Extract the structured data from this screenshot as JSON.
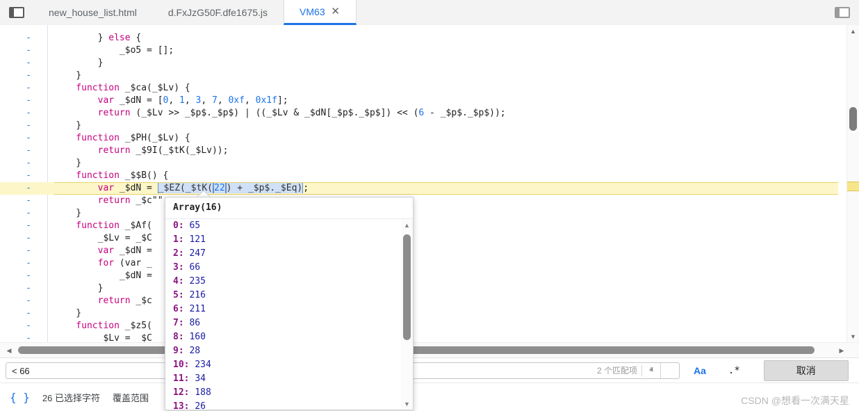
{
  "window": {
    "left_panel_toggle": "toggle-left-panel",
    "right_panel_toggle": "toggle-right-panel"
  },
  "tabs": [
    {
      "label": "new_house_list.html",
      "active": false,
      "closable": false
    },
    {
      "label": "d.FxJzG50F.dfe1675.js",
      "active": false,
      "closable": false
    },
    {
      "label": "VM63",
      "active": true,
      "closable": true,
      "close_glyph": "✕"
    }
  ],
  "editor": {
    "gutter_marker": "-",
    "lines": [
      {
        "indent": 0,
        "clipped": true,
        "tokens": []
      },
      {
        "tokens": [
          {
            "t": "pl",
            "v": "        } "
          },
          {
            "t": "kw",
            "v": "else"
          },
          {
            "t": "pl",
            "v": " {"
          }
        ]
      },
      {
        "tokens": [
          {
            "t": "pl",
            "v": "            _$o5 = [];"
          }
        ]
      },
      {
        "tokens": [
          {
            "t": "pl",
            "v": "        }"
          }
        ]
      },
      {
        "tokens": [
          {
            "t": "pl",
            "v": "    }"
          }
        ]
      },
      {
        "tokens": [
          {
            "t": "kw",
            "v": "    function"
          },
          {
            "t": "pl",
            "v": " _$ca(_$Lv) {"
          }
        ]
      },
      {
        "tokens": [
          {
            "t": "kw",
            "v": "        var"
          },
          {
            "t": "pl",
            "v": " _$dN = ["
          },
          {
            "t": "num",
            "v": "0"
          },
          {
            "t": "pl",
            "v": ", "
          },
          {
            "t": "num",
            "v": "1"
          },
          {
            "t": "pl",
            "v": ", "
          },
          {
            "t": "num",
            "v": "3"
          },
          {
            "t": "pl",
            "v": ", "
          },
          {
            "t": "num",
            "v": "7"
          },
          {
            "t": "pl",
            "v": ", "
          },
          {
            "t": "num",
            "v": "0xf"
          },
          {
            "t": "pl",
            "v": ", "
          },
          {
            "t": "num",
            "v": "0x1f"
          },
          {
            "t": "pl",
            "v": "];"
          }
        ]
      },
      {
        "tokens": [
          {
            "t": "kw",
            "v": "        return"
          },
          {
            "t": "pl",
            "v": " (_$Lv >> _$p$._$p$) | ((_$Lv & _$dN[_$p$._$p$]) << ("
          },
          {
            "t": "num",
            "v": "6"
          },
          {
            "t": "pl",
            "v": " - _$p$._$p$));"
          }
        ]
      },
      {
        "tokens": [
          {
            "t": "pl",
            "v": "    }"
          }
        ]
      },
      {
        "tokens": [
          {
            "t": "kw",
            "v": "    function"
          },
          {
            "t": "pl",
            "v": " _$PH(_$Lv) {"
          }
        ]
      },
      {
        "tokens": [
          {
            "t": "kw",
            "v": "        return"
          },
          {
            "t": "pl",
            "v": " _$9I(_$tK(_$Lv));"
          }
        ]
      },
      {
        "tokens": [
          {
            "t": "pl",
            "v": "    }"
          }
        ]
      },
      {
        "tokens": [
          {
            "t": "kw",
            "v": "    function"
          },
          {
            "t": "pl",
            "v": " _$$B() {"
          }
        ]
      },
      {
        "highlighted": true,
        "tokens": [
          {
            "t": "kw",
            "v": "        var"
          },
          {
            "t": "pl",
            "v": " _$dN = "
          },
          {
            "t": "sel",
            "v": "_$EZ(_$tK("
          },
          {
            "t": "selnum",
            "v": "22"
          },
          {
            "t": "sel",
            "v": ") + _$p$._$Eq)"
          },
          {
            "t": "pl",
            "v": ";"
          }
        ]
      },
      {
        "tokens": [
          {
            "t": "kw",
            "v": "        return"
          },
          {
            "t": "pl",
            "v": " _$c\"\""
          }
        ]
      },
      {
        "tokens": [
          {
            "t": "pl",
            "v": "    }"
          }
        ]
      },
      {
        "tokens": [
          {
            "t": "kw",
            "v": "    function"
          },
          {
            "t": "pl",
            "v": " _$Af("
          }
        ]
      },
      {
        "tokens": [
          {
            "t": "pl",
            "v": "        _$Lv = _$C"
          }
        ]
      },
      {
        "tokens": [
          {
            "t": "kw",
            "v": "        var"
          },
          {
            "t": "pl",
            "v": " _$dN ="
          }
        ]
      },
      {
        "tokens": [
          {
            "t": "kw",
            "v": "        for"
          },
          {
            "t": "pl",
            "v": " (var _"
          }
        ]
      },
      {
        "tokens": [
          {
            "t": "pl",
            "v": "            _$dN ="
          }
        ]
      },
      {
        "tokens": [
          {
            "t": "pl",
            "v": "        }"
          }
        ]
      },
      {
        "tokens": [
          {
            "t": "kw",
            "v": "        return"
          },
          {
            "t": "pl",
            "v": " _$c"
          }
        ]
      },
      {
        "tokens": [
          {
            "t": "pl",
            "v": "    }"
          }
        ]
      },
      {
        "tokens": [
          {
            "t": "kw",
            "v": "    function"
          },
          {
            "t": "pl",
            "v": " _$z5("
          }
        ]
      },
      {
        "tokens": [
          {
            "t": "pl",
            "v": "        _$Lv = _$C"
          }
        ]
      }
    ]
  },
  "popup": {
    "title": "Array(16)",
    "properties": [
      {
        "key": "0",
        "value": "65"
      },
      {
        "key": "1",
        "value": "121"
      },
      {
        "key": "2",
        "value": "247"
      },
      {
        "key": "3",
        "value": "66"
      },
      {
        "key": "4",
        "value": "235"
      },
      {
        "key": "5",
        "value": "216"
      },
      {
        "key": "6",
        "value": "211"
      },
      {
        "key": "7",
        "value": "86"
      },
      {
        "key": "8",
        "value": "160"
      },
      {
        "key": "9",
        "value": "28"
      },
      {
        "key": "10",
        "value": "234"
      },
      {
        "key": "11",
        "value": "34"
      },
      {
        "key": "12",
        "value": "188"
      },
      {
        "key": "13",
        "value": "26"
      }
    ],
    "scroll_up_glyph": "▲",
    "scroll_down_glyph": "▼"
  },
  "findbar": {
    "value": "< 66",
    "placeholder": "",
    "match_count": "2 个匹配项",
    "prev_glyph": "ⱏ",
    "next_glyph": "ⱟ",
    "match_case_label": "Aa",
    "regex_label": ".*",
    "cancel_label": "取消"
  },
  "statusbar": {
    "pretty_print": "{ }",
    "selection_info": "26 已选择字符",
    "coverage_label": "覆盖范围"
  },
  "watermark": "CSDN @想看一次满天星",
  "scrollbars": {
    "up_glyph": "▲",
    "down_glyph": "▼",
    "left_glyph": "◀",
    "right_glyph": "▶"
  },
  "colors": {
    "accent": "#1a73e8",
    "keyword": "#c6007e",
    "number": "#1a73e8",
    "highlight": "#fdf6c8",
    "selection": "#cfe0f7",
    "prop_key": "#881280",
    "prop_value": "#1a1aa6"
  }
}
